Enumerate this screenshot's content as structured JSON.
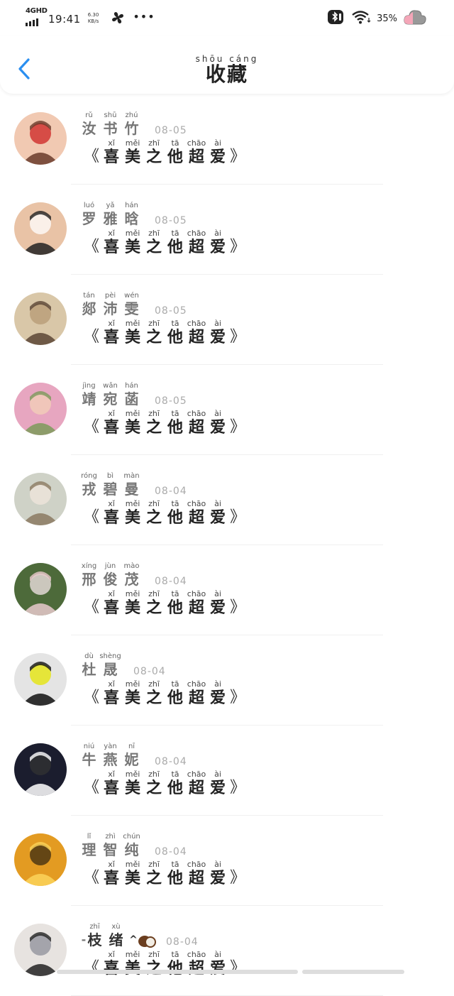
{
  "status": {
    "network": "4GHD",
    "time": "19:41",
    "speed_value": "6.30",
    "speed_unit": "KB/s",
    "dots": "•••",
    "battery": "35%"
  },
  "header": {
    "title_pinyin": "shōu cáng",
    "title": "收藏"
  },
  "message": {
    "open_bracket": "《",
    "close_bracket": "》",
    "chars": [
      {
        "py": "xǐ",
        "hz": "喜"
      },
      {
        "py": "měi",
        "hz": "美"
      },
      {
        "py": "zhī",
        "hz": "之"
      },
      {
        "py": "tā",
        "hz": "他"
      },
      {
        "py": "chāo",
        "hz": "超"
      },
      {
        "py": "ài",
        "hz": "爱"
      }
    ]
  },
  "items": [
    {
      "name": [
        {
          "py": "rǔ",
          "hz": "汝"
        },
        {
          "py": "shū",
          "hz": "书"
        },
        {
          "py": "zhú",
          "hz": "竹"
        }
      ],
      "date": "08-05",
      "avatar_colors": [
        "#f1c9b2",
        "#6a3b2a",
        "#c22"
      ]
    },
    {
      "name": [
        {
          "py": "luó",
          "hz": "罗"
        },
        {
          "py": "yǎ",
          "hz": "雅"
        },
        {
          "py": "hán",
          "hz": "晗"
        }
      ],
      "date": "08-05",
      "avatar_colors": [
        "#e9c3a6",
        "#222",
        "#fff"
      ]
    },
    {
      "name": [
        {
          "py": "tán",
          "hz": "郯"
        },
        {
          "py": "pèi",
          "hz": "沛"
        },
        {
          "py": "wén",
          "hz": "雯"
        }
      ],
      "date": "08-05",
      "avatar_colors": [
        "#d9c7a8",
        "#5a4535",
        "#b59a74"
      ]
    },
    {
      "name": [
        {
          "py": "jìng",
          "hz": "靖"
        },
        {
          "py": "wǎn",
          "hz": "宛"
        },
        {
          "py": "hán",
          "hz": "菡"
        }
      ],
      "date": "08-05",
      "avatar_colors": [
        "#e7a6c0",
        "#7d9a5b",
        "#f3d0b8"
      ]
    },
    {
      "name": [
        {
          "py": "róng",
          "hz": "戎"
        },
        {
          "py": "bì",
          "hz": "碧"
        },
        {
          "py": "màn",
          "hz": "曼"
        }
      ],
      "date": "08-04",
      "avatar_colors": [
        "#cfd2c7",
        "#8b7a62",
        "#f0e6dc"
      ]
    },
    {
      "name": [
        {
          "py": "xíng",
          "hz": "邢"
        },
        {
          "py": "jùn",
          "hz": "俊"
        },
        {
          "py": "mào",
          "hz": "茂"
        }
      ],
      "date": "08-04",
      "avatar_colors": [
        "#4d6a3a",
        "#e8c9cc",
        "#f6e7e9"
      ]
    },
    {
      "name": [
        {
          "py": "dù",
          "hz": "杜"
        },
        {
          "py": "shèng",
          "hz": "晟"
        }
      ],
      "date": "08-04",
      "avatar_colors": [
        "#e4e4e4",
        "#111",
        "#e6e600"
      ]
    },
    {
      "name": [
        {
          "py": "niú",
          "hz": "牛"
        },
        {
          "py": "yàn",
          "hz": "燕"
        },
        {
          "py": "nī",
          "hz": "妮"
        }
      ],
      "date": "08-04",
      "avatar_colors": [
        "#1b1d2e",
        "#ffffff",
        "#333"
      ]
    },
    {
      "name": [
        {
          "py": "lǐ",
          "hz": "理"
        },
        {
          "py": "zhì",
          "hz": "智"
        },
        {
          "py": "chún",
          "hz": "纯"
        }
      ],
      "date": "08-04",
      "avatar_colors": [
        "#e39b22",
        "#fbd35a",
        "#3a2a12"
      ]
    },
    {
      "name": [
        {
          "py": "zhī",
          "hz": "枝"
        },
        {
          "py": "xù",
          "hz": "绪"
        }
      ],
      "name_prefix": "-",
      "name_suffix": "^",
      "date": "08-04",
      "avatar_colors": [
        "#e7e3e0",
        "#222",
        "#8d8f99"
      ]
    }
  ]
}
